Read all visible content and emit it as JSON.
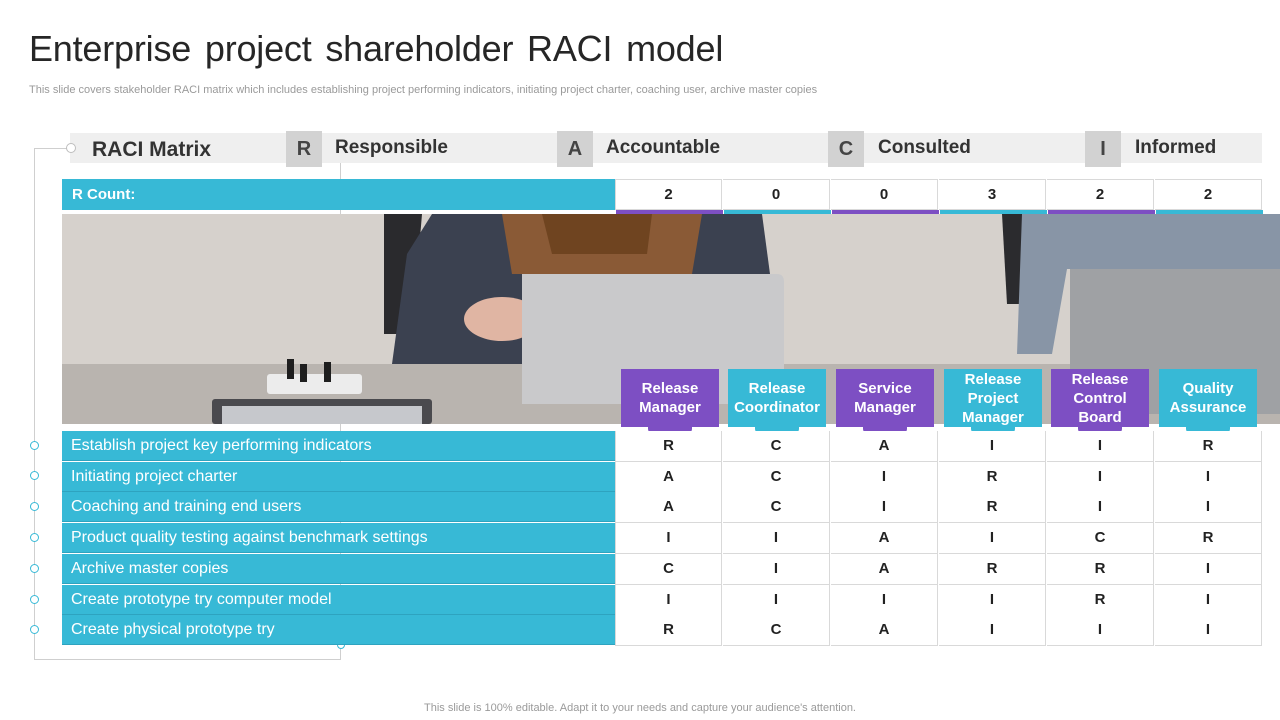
{
  "title": "Enterprise  project shareholder  RACI model",
  "subtitle": "This slide covers stakeholder RACI matrix  which includes establishing project performing indicators, initiating project charter, coaching user, archive master copies",
  "footer": "This slide is 100% editable. Adapt it to your needs and capture your audience's attention.",
  "legend": {
    "matrix_label": "RACI Matrix",
    "items": [
      {
        "letter": "R",
        "label": "Responsible"
      },
      {
        "letter": "A",
        "label": "Accountable"
      },
      {
        "letter": "C",
        "label": "Consulted"
      },
      {
        "letter": "I",
        "label": "Informed"
      }
    ]
  },
  "count_label": "R Count:",
  "counts": [
    "2",
    "0",
    "0",
    "3",
    "2",
    "2"
  ],
  "roles": [
    {
      "label": "Release Manager",
      "color": "#7d4fc3"
    },
    {
      "label": "Release Coordinator",
      "color": "#37b9d6"
    },
    {
      "label": "Service Manager",
      "color": "#7d4fc3"
    },
    {
      "label": "Release Project Manager",
      "color": "#37b9d6"
    },
    {
      "label": "Release Control Board",
      "color": "#7d4fc3"
    },
    {
      "label": "Quality Assurance",
      "color": "#37b9d6"
    }
  ],
  "rows": [
    {
      "activity": "Establish project key performing indicators",
      "values": [
        "R",
        "C",
        "A",
        "I",
        "I",
        "R"
      ]
    },
    {
      "activity": "Initiating project charter",
      "values": [
        "A",
        "C",
        "I",
        "R",
        "I",
        "I"
      ]
    },
    {
      "activity": "Coaching and training end users",
      "values": [
        "A",
        "C",
        "I",
        "R",
        "I",
        "I"
      ]
    },
    {
      "activity": "Product quality testing against benchmark settings",
      "values": [
        "I",
        "I",
        "A",
        "I",
        "C",
        "R"
      ]
    },
    {
      "activity": "Archive master copies",
      "values": [
        "C",
        "I",
        "A",
        "R",
        "R",
        "I"
      ]
    },
    {
      "activity": "Create prototype try computer model",
      "values": [
        "I",
        "I",
        "I",
        "I",
        "R",
        "I"
      ]
    },
    {
      "activity": "Create physical prototype try",
      "values": [
        "R",
        "C",
        "A",
        "I",
        "I",
        "I"
      ]
    }
  ],
  "colors": {
    "primary": "#37b9d6",
    "secondary": "#7d4fc3"
  }
}
